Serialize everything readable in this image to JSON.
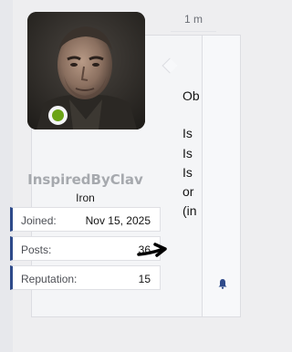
{
  "user": {
    "name": "InspiredByClav",
    "title": "Iron",
    "online_color": "#6ba317",
    "stats": [
      {
        "label": "Joined:",
        "value": "Nov 15, 2025"
      },
      {
        "label": "Posts:",
        "value": "36"
      },
      {
        "label": "Reputation:",
        "value": "15"
      }
    ]
  },
  "message": {
    "time_fragment": "1 m",
    "lines": [
      "Ob",
      "Is",
      "Is",
      "Is",
      "or",
      "(in"
    ]
  },
  "icons": {
    "annotation": "arrow-right-icon",
    "bell": "bell-icon"
  },
  "colors": {
    "accent": "#2e4a8a",
    "bell": "#2e4a8a"
  }
}
